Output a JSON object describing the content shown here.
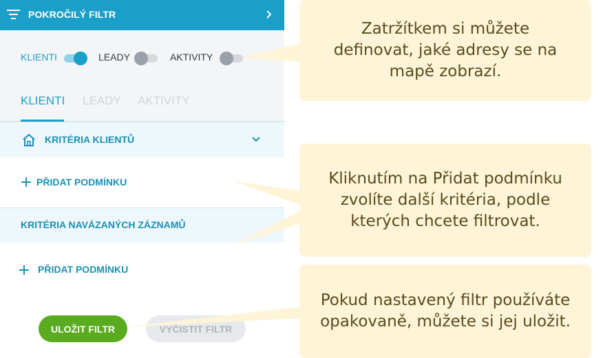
{
  "header": {
    "title": "POKROČILÝ FILTR",
    "menu_icon": "filter-lines-icon",
    "expand_icon": "chevron-right-icon"
  },
  "toggles": [
    {
      "label": "KLIENTI",
      "on": true
    },
    {
      "label": "LEADY",
      "on": false
    },
    {
      "label": "AKTIVITY",
      "on": false
    }
  ],
  "tabs": [
    {
      "label": "KLIENTI",
      "active": true
    },
    {
      "label": "LEADY",
      "active": false
    },
    {
      "label": "AKTIVITY",
      "active": false
    }
  ],
  "client_criteria": {
    "label": "KRITÉRIA KLIENTŮ",
    "icon": "home-icon",
    "toggle_icon": "chevron-down-icon"
  },
  "add_condition_1": {
    "label": "PŘIDAT PODMÍNKU"
  },
  "related_criteria": {
    "label": "KRITÉRIA NAVÁZANÝCH ZÁZNAMŮ"
  },
  "add_condition_2": {
    "label": "PŘIDAT PODMÍNKU"
  },
  "buttons": {
    "save": "ULOŽIT FILTR",
    "clear": "VYČISTIT FILTR"
  },
  "callouts": [
    {
      "lines": [
        "Zatržítkem si můžete",
        "definovat, jaké adresy se na",
        "mapě zobrazí."
      ]
    },
    {
      "lines": [
        "Kliknutím na Přidat podmínku",
        "zvolíte další kritéria, podle",
        "kterých chcete filtrovat."
      ]
    },
    {
      "lines": [
        "Pokud nastavený filtr používáte",
        "opakovaně, můžete si jej uložit."
      ]
    }
  ],
  "colors": {
    "accent": "#1a9fc8",
    "toggle_on_track": "#8fd2ea",
    "toggle_off_knob": "#9aa1ab",
    "toggle_off_track": "#d6d9dd",
    "save_button": "#5aab1f",
    "callout_bg": "#fef5d8",
    "callout_text": "#5a4a1e"
  }
}
